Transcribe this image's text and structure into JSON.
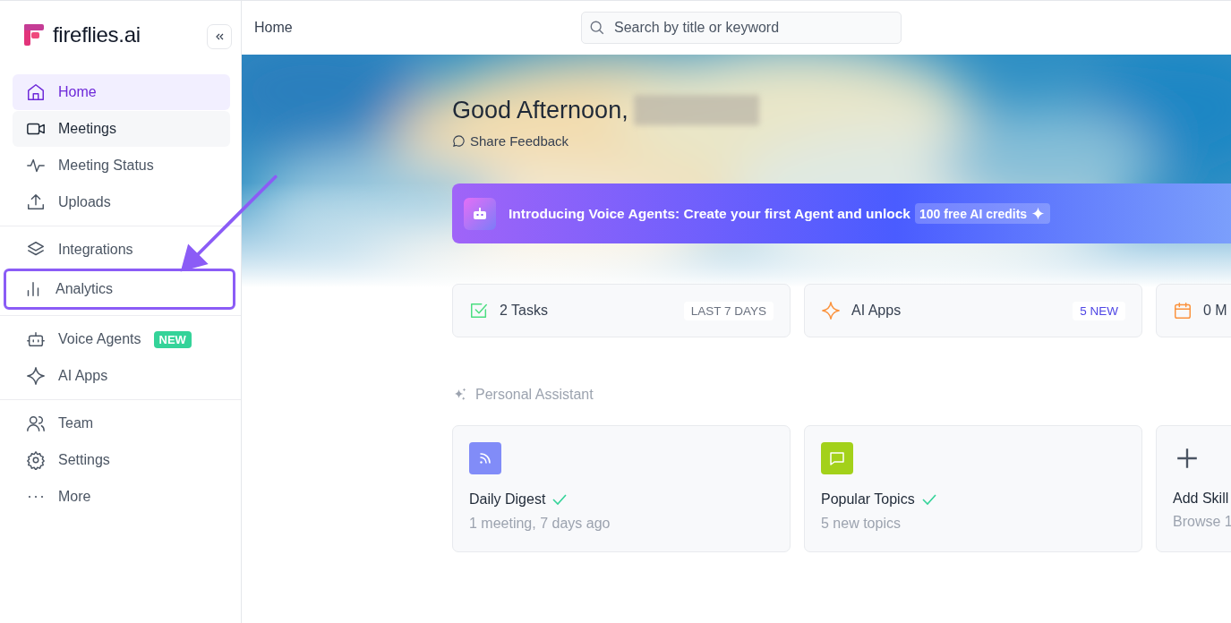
{
  "sidebar": {
    "logo": "fireflies.ai",
    "groups": [
      {
        "items": [
          {
            "label": "Home",
            "selected": true,
            "hovered": false,
            "highlighted": false
          },
          {
            "label": "Meetings",
            "selected": false,
            "hovered": true,
            "highlighted": false
          },
          {
            "label": "Meeting Status",
            "selected": false,
            "hovered": false,
            "highlighted": false
          },
          {
            "label": "Uploads",
            "selected": false,
            "hovered": false,
            "highlighted": false
          }
        ]
      },
      {
        "items": [
          {
            "label": "Integrations",
            "selected": false,
            "hovered": false,
            "highlighted": false
          },
          {
            "label": "Analytics",
            "selected": false,
            "hovered": false,
            "highlighted": true
          }
        ]
      },
      {
        "items": [
          {
            "label": "Voice Agents",
            "selected": false,
            "hovered": false,
            "highlighted": false,
            "badge": "NEW"
          },
          {
            "label": "AI Apps",
            "selected": false,
            "hovered": false,
            "highlighted": false
          }
        ]
      },
      {
        "items": [
          {
            "label": "Team",
            "selected": false,
            "hovered": false,
            "highlighted": false
          },
          {
            "label": "Settings",
            "selected": false,
            "hovered": false,
            "highlighted": false
          },
          {
            "label": "More",
            "selected": false,
            "hovered": false,
            "highlighted": false
          }
        ]
      }
    ]
  },
  "topbar": {
    "breadcrumb": "Home",
    "search": {
      "placeholder": "Search by title or keyword"
    }
  },
  "hero": {
    "greeting": "Good Afternoon,",
    "feedback": "Share Feedback"
  },
  "banner": {
    "text": "Introducing Voice Agents: Create your first Agent and unlock",
    "pill": "100 free AI credits"
  },
  "stats": [
    {
      "label": "2 Tasks",
      "badge": "LAST 7 DAYS",
      "color": "#6b7280"
    },
    {
      "label": "AI Apps",
      "badge": "5 NEW",
      "color": "#4f46e5"
    },
    {
      "label": "0 M"
    }
  ],
  "section": {
    "title": "Personal Assistant"
  },
  "skills": [
    {
      "kind": "skill",
      "title": "Daily Digest",
      "done": true,
      "subtitle": "1 meeting, 7 days ago",
      "color": "#818cf8"
    },
    {
      "kind": "skill",
      "title": "Popular Topics",
      "done": true,
      "subtitle": "5 new topics",
      "color": "#a3d11a"
    },
    {
      "kind": "add",
      "title": "Add Skill",
      "subtitle": "Browse 1"
    }
  ]
}
